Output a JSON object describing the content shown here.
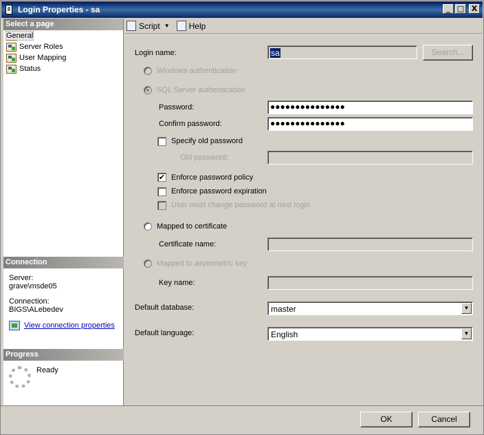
{
  "window": {
    "title": "Login Properties - sa"
  },
  "titlebar_buttons": {
    "minimize": "_",
    "maximize": "□",
    "close": "X"
  },
  "left": {
    "select_page_header": "Select a page",
    "pages": [
      {
        "label": "General",
        "selected": true
      },
      {
        "label": "Server Roles"
      },
      {
        "label": "User Mapping"
      },
      {
        "label": "Status"
      }
    ],
    "connection_header": "Connection",
    "server_label": "Server:",
    "server_value": "grave\\msde05",
    "connection_label": "Connection:",
    "connection_value": "BIGS\\ALebedev",
    "view_link": "View connection properties",
    "progress_header": "Progress",
    "progress_status": "Ready"
  },
  "toolbar": {
    "script_label": "Script",
    "help_label": "Help"
  },
  "form": {
    "login_name_label": "Login name:",
    "login_name_value": "sa",
    "search_button": "Search...",
    "windows_auth": "Windows authentication",
    "sql_auth": "SQL Server authentication",
    "password_label": "Password:",
    "password_value": "●●●●●●●●●●●●●●●",
    "confirm_label": "Confirm password:",
    "confirm_value": "●●●●●●●●●●●●●●●",
    "specify_old": "Specify old password",
    "old_password_label": "Old password:",
    "enforce_policy": "Enforce password policy",
    "enforce_expiration": "Enforce password expiration",
    "must_change": "User must change password at next login",
    "mapped_cert": "Mapped to certificate",
    "cert_name_label": "Certificate name:",
    "mapped_asym": "Mapped to asymmetric key",
    "key_name_label": "Key name:",
    "default_db_label": "Default database:",
    "default_db_value": "master",
    "default_lang_label": "Default language:",
    "default_lang_value": "English",
    "check_mark": "✔"
  },
  "buttons": {
    "ok": "OK",
    "cancel": "Cancel"
  }
}
